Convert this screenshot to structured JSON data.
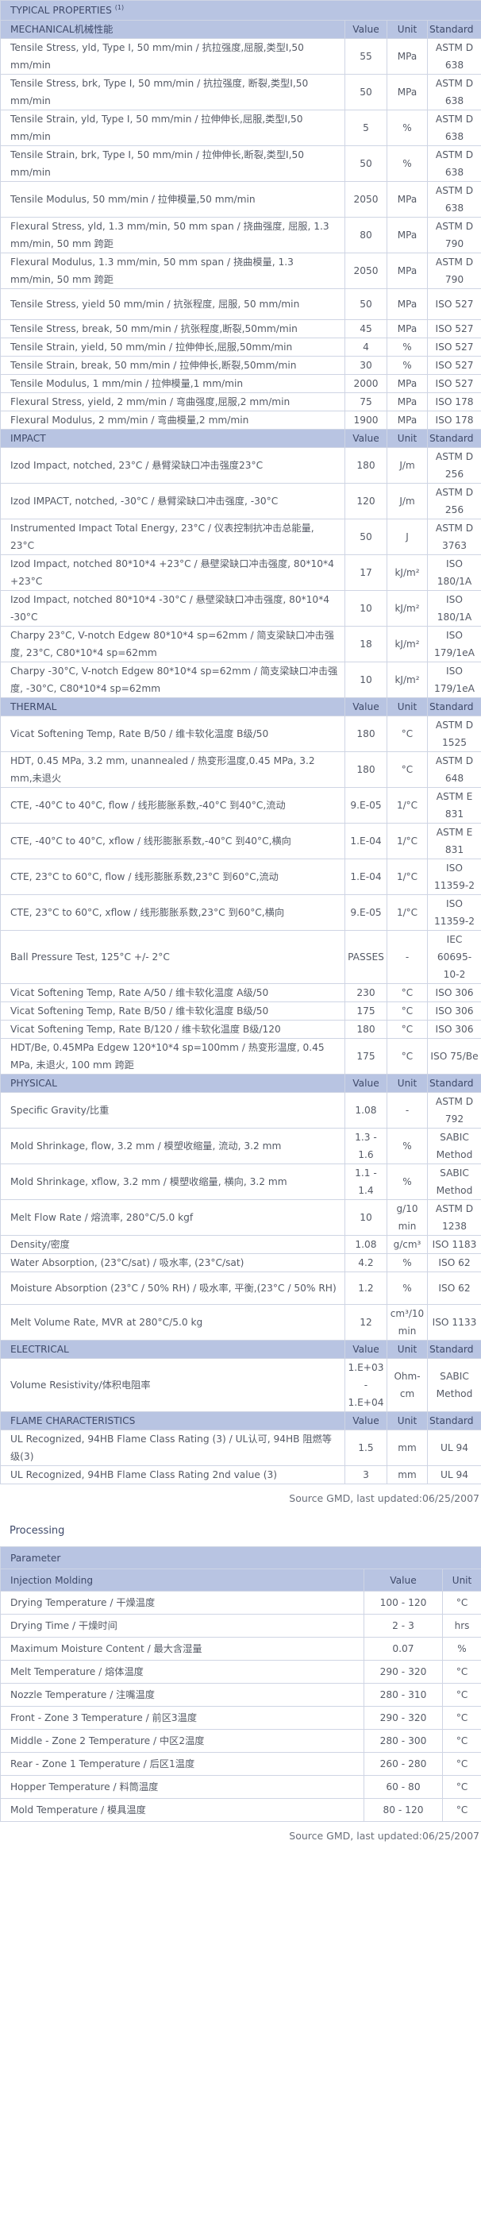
{
  "source_note": "Source GMD, last updated:06/25/2007",
  "properties": {
    "title": "TYPICAL PROPERTIES",
    "title_sup": "(1)",
    "sections": [
      {
        "name": "MECHANICAL机械性能",
        "col_value": "Value",
        "col_unit": "Unit",
        "col_standard": "Standard",
        "rows": [
          {
            "prop": "Tensile Stress, yld, Type I, 50 mm/min / 抗拉强度,屈服,类型I,50 mm/min",
            "value": "55",
            "unit": "MPa",
            "std": "ASTM D 638"
          },
          {
            "prop": "Tensile Stress, brk, Type I, 50 mm/min / 抗拉强度, 断裂,类型I,50 mm/min",
            "value": "50",
            "unit": "MPa",
            "std": "ASTM D 638"
          },
          {
            "prop": "Tensile Strain, yld, Type I, 50 mm/min / 拉伸伸长,屈服,类型I,50 mm/min",
            "value": "5",
            "unit": "%",
            "std": "ASTM D 638"
          },
          {
            "prop": "Tensile Strain, brk, Type I, 50 mm/min / 拉伸伸长,断裂,类型I,50 mm/min",
            "value": "50",
            "unit": "%",
            "std": "ASTM D 638"
          },
          {
            "prop": "Tensile Modulus, 50 mm/min / 拉伸模量,50 mm/min",
            "value": "2050",
            "unit": "MPa",
            "std": "ASTM D 638"
          },
          {
            "prop": "Flexural Stress, yld, 1.3 mm/min, 50 mm span / 挠曲强度, 屈服, 1.3 mm/min, 50 mm 跨距",
            "value": "80",
            "unit": "MPa",
            "std": "ASTM D 790"
          },
          {
            "prop": "Flexural Modulus, 1.3 mm/min, 50 mm span / 挠曲模量, 1.3 mm/min, 50 mm 跨距",
            "value": "2050",
            "unit": "MPa",
            "std": "ASTM D 790"
          },
          {
            "prop": "Tensile Stress, yield 50 mm/min / 抗张程度, 屈服, 50 mm/min",
            "value": "50",
            "unit": "MPa",
            "std": "ISO 527"
          },
          {
            "prop": "Tensile Stress, break, 50 mm/min / 抗张程度,断裂,50mm/min",
            "value": "45",
            "unit": "MPa",
            "std": "ISO 527"
          },
          {
            "prop": "Tensile Strain, yield, 50 mm/min / 拉伸伸长,屈服,50mm/min",
            "value": "4",
            "unit": "%",
            "std": "ISO 527"
          },
          {
            "prop": "Tensile Strain, break, 50 mm/min / 拉伸伸长,断裂,50mm/min",
            "value": "30",
            "unit": "%",
            "std": "ISO 527"
          },
          {
            "prop": "Tensile Modulus, 1 mm/min / 拉伸模量,1 mm/min",
            "value": "2000",
            "unit": "MPa",
            "std": "ISO 527"
          },
          {
            "prop": "Flexural Stress, yield, 2 mm/min / 弯曲强度,屈服,2 mm/min",
            "value": "75",
            "unit": "MPa",
            "std": "ISO 178"
          },
          {
            "prop": "Flexural Modulus, 2 mm/min / 弯曲模量,2 mm/min",
            "value": "1900",
            "unit": "MPa",
            "std": "ISO 178"
          }
        ]
      },
      {
        "name": "IMPACT",
        "col_value": "Value",
        "col_unit": "Unit",
        "col_standard": "Standard",
        "rows": [
          {
            "prop": "Izod Impact, notched, 23°C / 悬臂梁缺口冲击强度23°C",
            "value": "180",
            "unit": "J/m",
            "std": "ASTM D 256"
          },
          {
            "prop": "Izod IMPACT, notched, -30°C / 悬臂梁缺口冲击强度, -30°C",
            "value": "120",
            "unit": "J/m",
            "std": "ASTM D 256"
          },
          {
            "prop": "Instrumented Impact Total Energy, 23°C / 仪表控制抗冲击总能量, 23°C",
            "value": "50",
            "unit": "J",
            "std": "ASTM D 3763"
          },
          {
            "prop": "Izod Impact, notched 80*10*4 +23°C / 悬壁梁缺口冲击强度, 80*10*4 +23°C",
            "value": "17",
            "unit": "kJ/m²",
            "std": "ISO 180/1A"
          },
          {
            "prop": "Izod Impact, notched 80*10*4 -30°C / 悬壁梁缺口冲击强度, 80*10*4 -30°C",
            "value": "10",
            "unit": "kJ/m²",
            "std": "ISO 180/1A"
          },
          {
            "prop": "Charpy 23°C, V-notch Edgew 80*10*4 sp=62mm / 简支梁缺口冲击强度, 23°C, C80*10*4 sp=62mm",
            "value": "18",
            "unit": "kJ/m²",
            "std": "ISO 179/1eA"
          },
          {
            "prop": "Charpy -30°C, V-notch Edgew 80*10*4 sp=62mm / 简支梁缺口冲击强度, -30°C, C80*10*4 sp=62mm",
            "value": "10",
            "unit": "kJ/m²",
            "std": "ISO 179/1eA"
          }
        ]
      },
      {
        "name": "THERMAL",
        "col_value": "Value",
        "col_unit": "Unit",
        "col_standard": "Standard",
        "rows": [
          {
            "prop": "Vicat Softening Temp, Rate B/50 / 维卡软化温度 B级/50",
            "value": "180",
            "unit": "°C",
            "std": "ASTM D 1525"
          },
          {
            "prop": "HDT, 0.45 MPa, 3.2 mm, unannealed / 热变形温度,0.45 MPa, 3.2 mm,未退火",
            "value": "180",
            "unit": "°C",
            "std": "ASTM D 648"
          },
          {
            "prop": "CTE, -40°C to 40°C, flow / 线形膨胀系数,-40°C 到40°C,流动",
            "value": "9.E-05",
            "unit": "1/°C",
            "std": "ASTM E 831"
          },
          {
            "prop": "CTE, -40°C to 40°C, xflow / 线形膨胀系数,-40°C 到40°C,横向",
            "value": "1.E-04",
            "unit": "1/°C",
            "std": "ASTM E 831"
          },
          {
            "prop": "CTE, 23°C to 60°C, flow / 线形膨胀系数,23°C 到60°C,流动",
            "value": "1.E-04",
            "unit": "1/°C",
            "std": "ISO 11359-2"
          },
          {
            "prop": "CTE, 23°C to 60°C, xflow / 线形膨胀系数,23°C 到60°C,横向",
            "value": "9.E-05",
            "unit": "1/°C",
            "std": "ISO 11359-2"
          },
          {
            "prop": "Ball Pressure Test, 125°C +/- 2°C",
            "value": "PASSES",
            "unit": "-",
            "std": "IEC 60695-10-2"
          },
          {
            "prop": "Vicat Softening Temp, Rate A/50 / 维卡软化温度 A级/50",
            "value": "230",
            "unit": "°C",
            "std": "ISO 306"
          },
          {
            "prop": "Vicat Softening Temp, Rate B/50 / 维卡软化温度 B级/50",
            "value": "175",
            "unit": "°C",
            "std": "ISO 306"
          },
          {
            "prop": "Vicat Softening Temp, Rate B/120 / 维卡软化温度 B级/120",
            "value": "180",
            "unit": "°C",
            "std": "ISO 306"
          },
          {
            "prop": "HDT/Be, 0.45MPa Edgew 120*10*4 sp=100mm / 热变形温度, 0.45 MPa, 未退火, 100 mm 跨距",
            "value": "175",
            "unit": "°C",
            "std": "ISO 75/Be"
          }
        ]
      },
      {
        "name": "PHYSICAL",
        "col_value": "Value",
        "col_unit": "Unit",
        "col_standard": "Standard",
        "rows": [
          {
            "prop": "Specific Gravity/比重",
            "value": "1.08",
            "unit": "-",
            "std": "ASTM D 792"
          },
          {
            "prop": "Mold Shrinkage, flow, 3.2 mm / 模塑收缩量, 流动, 3.2 mm",
            "value": "1.3 - 1.6",
            "unit": "%",
            "std": "SABIC Method"
          },
          {
            "prop": "Mold Shrinkage, xflow, 3.2 mm / 模塑收缩量, 横向, 3.2 mm",
            "value": "1.1 - 1.4",
            "unit": "%",
            "std": "SABIC Method"
          },
          {
            "prop": "Melt Flow Rate / 熔流率, 280°C/5.0 kgf",
            "value": "10",
            "unit": "g/10 min",
            "std": "ASTM D 1238"
          },
          {
            "prop": "Density/密度",
            "value": "1.08",
            "unit": "g/cm³",
            "std": "ISO 1183"
          },
          {
            "prop": "Water Absorption, (23°C/sat) / 吸水率, (23°C/sat)",
            "value": "4.2",
            "unit": "%",
            "std": "ISO 62"
          },
          {
            "prop": "Moisture Absorption (23°C / 50% RH) / 吸水率, 平衡,(23°C / 50% RH)",
            "value": "1.2",
            "unit": "%",
            "std": "ISO 62"
          },
          {
            "prop": "Melt Volume Rate, MVR at 280°C/5.0 kg",
            "value": "12",
            "unit": "cm³/10 min",
            "std": "ISO 1133"
          }
        ]
      },
      {
        "name": "ELECTRICAL",
        "col_value": "Value",
        "col_unit": "Unit",
        "col_standard": "Standard",
        "rows": [
          {
            "prop": "Volume Resistivity/体积电阻率",
            "value": "1.E+03 - 1.E+04",
            "unit": "Ohm-cm",
            "std": "SABIC Method"
          }
        ]
      },
      {
        "name": "FLAME CHARACTERISTICS",
        "col_value": "Value",
        "col_unit": "Unit",
        "col_standard": "Standard",
        "rows": [
          {
            "prop": "UL Recognized, 94HB Flame Class Rating (3) / UL认可, 94HB 阻燃等级(3)",
            "value": "1.5",
            "unit": "mm",
            "std": "UL 94"
          },
          {
            "prop": "UL Recognized, 94HB Flame Class Rating 2nd value (3)",
            "value": "3",
            "unit": "mm",
            "std": "UL 94"
          }
        ]
      }
    ]
  },
  "processing": {
    "title": "Processing",
    "header": {
      "name": "Parameter"
    },
    "section": {
      "name": "Injection Molding",
      "col_value": "Value",
      "col_unit": "Unit"
    },
    "rows": [
      {
        "prop": "Drying Temperature / 干燥温度",
        "value": "100 - 120",
        "unit": "°C"
      },
      {
        "prop": "Drying Time / 干燥时间",
        "value": "2 - 3",
        "unit": "hrs"
      },
      {
        "prop": "Maximum Moisture Content / 最大含湿量",
        "value": "0.07",
        "unit": "%"
      },
      {
        "prop": "Melt Temperature / 熔体温度",
        "value": "290 - 320",
        "unit": "°C"
      },
      {
        "prop": "Nozzle Temperature / 注嘴温度",
        "value": "280 - 310",
        "unit": "°C"
      },
      {
        "prop": "Front - Zone 3 Temperature / 前区3温度",
        "value": "290 - 320",
        "unit": "°C"
      },
      {
        "prop": "Middle - Zone 2 Temperature / 中区2温度",
        "value": "280 - 300",
        "unit": "°C"
      },
      {
        "prop": "Rear - Zone 1 Temperature / 后区1温度",
        "value": "260 - 280",
        "unit": "°C"
      },
      {
        "prop": "Hopper Temperature / 料筒温度",
        "value": "60 - 80",
        "unit": "°C"
      },
      {
        "prop": "Mold Temperature / 模具温度",
        "value": "80 - 120",
        "unit": "°C"
      }
    ]
  }
}
